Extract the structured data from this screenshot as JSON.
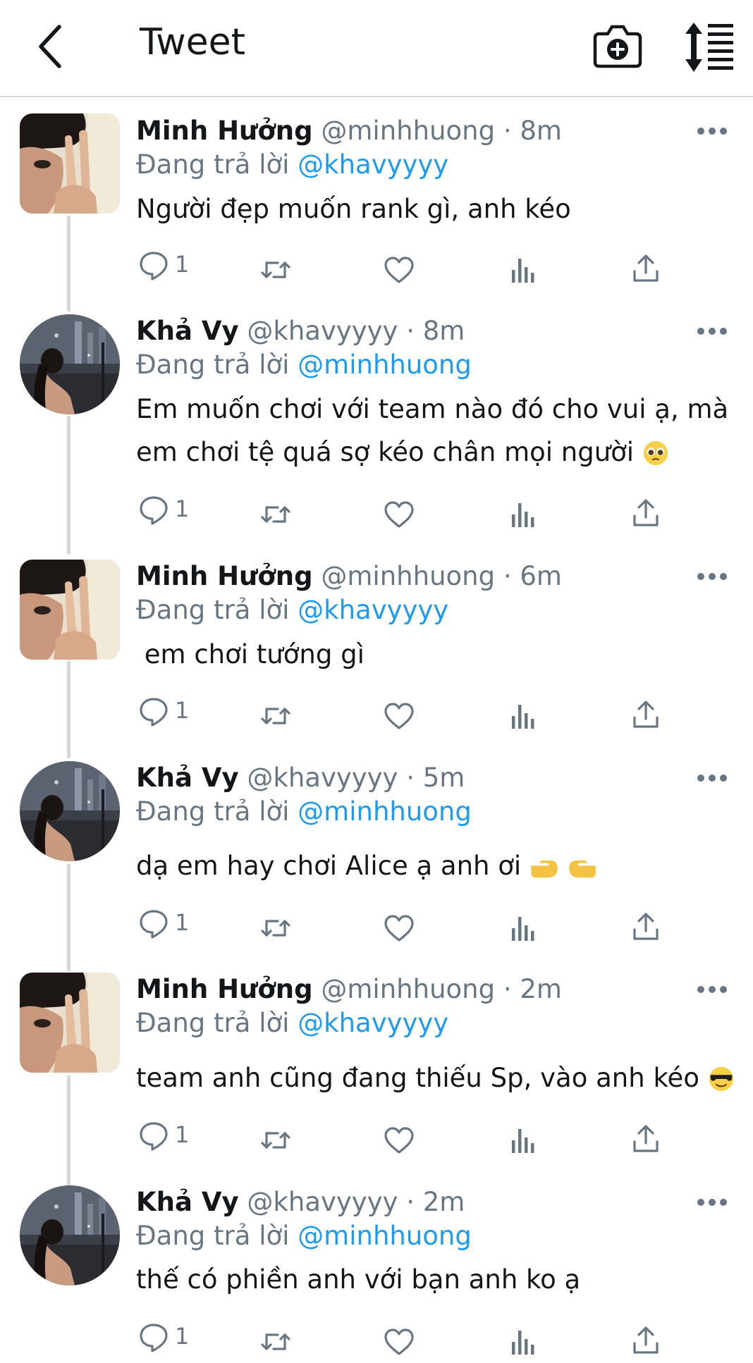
{
  "header": {
    "title": "Tweet",
    "back_icon": "back-arrow-icon",
    "camera_icon": "camera-plus-icon",
    "sort_icon": "sort-lines-icon"
  },
  "colors": {
    "accent": "#1d9bf0",
    "muted": "#687684",
    "text": "#14171a",
    "divider": "#d6d9dc"
  },
  "tweets": [
    {
      "name": "Minh Hưởng",
      "handle": "@minhhuong",
      "time": "· 8m",
      "replying_label": "Đang trả lời",
      "replying_to": "@khavyyyy",
      "text": "Người đẹp muốn rank gì, anh kéo",
      "reply_count": "1"
    },
    {
      "name": "Khả Vy",
      "handle": "@khavyyyy",
      "time": "· 8m",
      "replying_label": "Đang trả lời",
      "replying_to": "@minhhuong",
      "text": "Em muốn chơi với team nào đó cho vui ạ, mà em chơi tệ quá sợ kéo chân mọi người",
      "reply_count": "1"
    },
    {
      "name": "Minh Hưởng",
      "handle": "@minhhuong",
      "time": "· 6m",
      "replying_label": "Đang trả lời",
      "replying_to": "@khavyyyy",
      "text": " em chơi tướng gì",
      "reply_count": "1"
    },
    {
      "name": "Khả Vy",
      "handle": "@khavyyyy",
      "time": "· 5m",
      "replying_label": "Đang trả lời",
      "replying_to": "@minhhuong",
      "text": "dạ em hay chơi Alice ạ anh ơi",
      "reply_count": "1"
    },
    {
      "name": "Minh Hưởng",
      "handle": "@minhhuong",
      "time": "· 2m",
      "replying_label": "Đang trả lời",
      "replying_to": "@khavyyyy",
      "text": "team anh cũng đang thiếu Sp, vào anh kéo",
      "reply_count": "1"
    },
    {
      "name": "Khả Vy",
      "handle": "@khavyyyy",
      "time": "· 2m",
      "replying_label": "Đang trả lời",
      "replying_to": "@minhhuong",
      "text": "thế có phiền anh với bạn anh ko ạ",
      "reply_count": "1"
    }
  ]
}
